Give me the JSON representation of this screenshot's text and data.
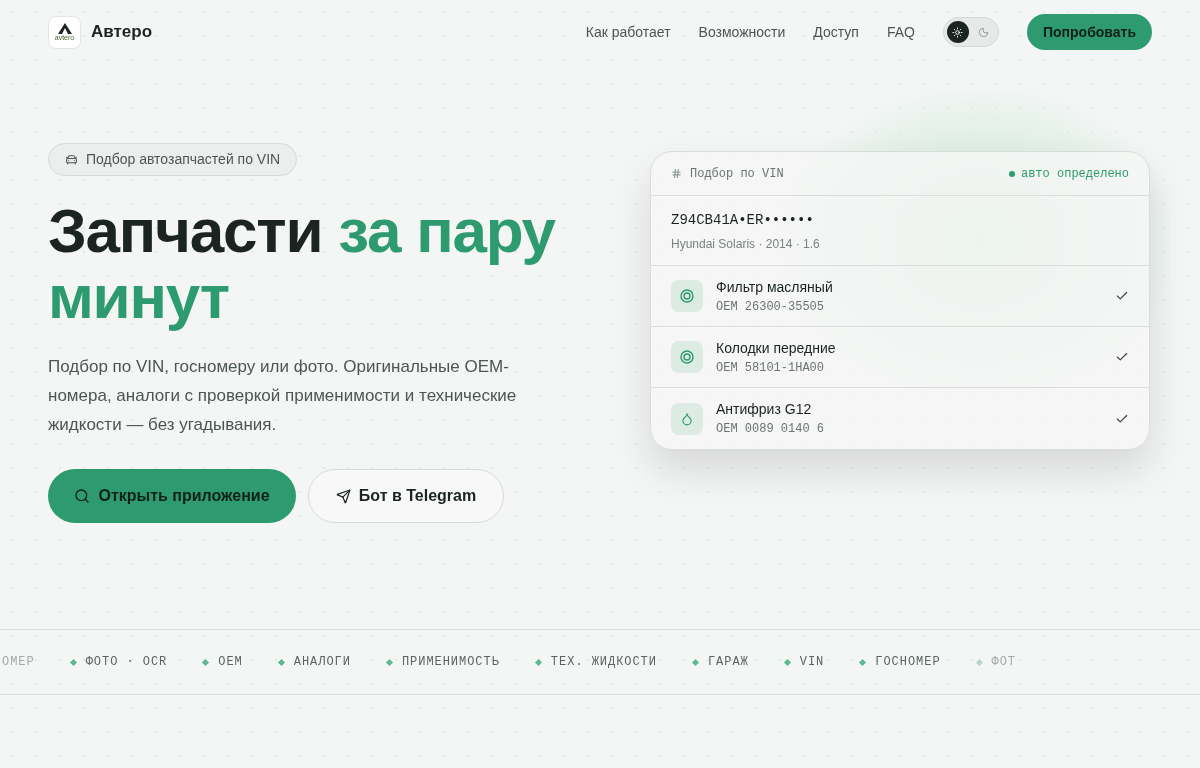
{
  "header": {
    "logo": {
      "text": "avtero"
    },
    "brand": "Автеро",
    "nav": [
      {
        "label": "Как работает"
      },
      {
        "label": "Возможности"
      },
      {
        "label": "Доступ"
      },
      {
        "label": "FAQ"
      }
    ],
    "theme_toggle": [
      {
        "kind": "sun",
        "selected": true
      },
      {
        "kind": "moon",
        "selected": false
      }
    ],
    "cta": "Попробовать"
  },
  "hero": {
    "badge": "Подбор автозапчастей по VIN",
    "title_plain": "Запчасти",
    "title_accent": "за пару минут",
    "description": "Подбор по VIN, госномеру или фото. Оригинальные OEM-номера, аналоги с проверкой применимости и технические жидкости — без угадывания.",
    "buttons": [
      {
        "kind": "primary",
        "label": "Открыть приложение"
      },
      {
        "kind": "secondary",
        "label": "Бот в Telegram"
      }
    ]
  },
  "card": {
    "title": "Подбор по VIN",
    "status": "авто определено",
    "vin": "Z94CB41A•ER••••••",
    "car": "Hyundai Solaris · 2014 · 1.6",
    "parts": [
      {
        "kind": "ring",
        "name": "Фильтр масляный",
        "oem": "OEM 26300-35505",
        "checked": true
      },
      {
        "kind": "ring",
        "name": "Колодки передние",
        "oem": "OEM 58101-1HA00",
        "checked": true
      },
      {
        "kind": "drop",
        "name": "Антифриз G12",
        "oem": "OEM 0089 0140 6",
        "checked": true
      }
    ]
  },
  "ticker": [
    {
      "label": "ОМЕР",
      "faded": true,
      "marker": false
    },
    {
      "label": "ФОТО · OCR",
      "faded": false,
      "marker": true
    },
    {
      "label": "OEM",
      "faded": false,
      "marker": true
    },
    {
      "label": "АНАЛОГИ",
      "faded": false,
      "marker": true
    },
    {
      "label": "ПРИМЕНИМОСТЬ",
      "faded": false,
      "marker": true
    },
    {
      "label": "ТЕХ. ЖИДКОСТИ",
      "faded": false,
      "marker": true
    },
    {
      "label": "ГАРАЖ",
      "faded": false,
      "marker": true
    },
    {
      "label": "VIN",
      "faded": false,
      "marker": true
    },
    {
      "label": "ГОСНОМЕР",
      "faded": false,
      "marker": true
    },
    {
      "label": "ФОТ",
      "faded": true,
      "marker": true
    }
  ]
}
